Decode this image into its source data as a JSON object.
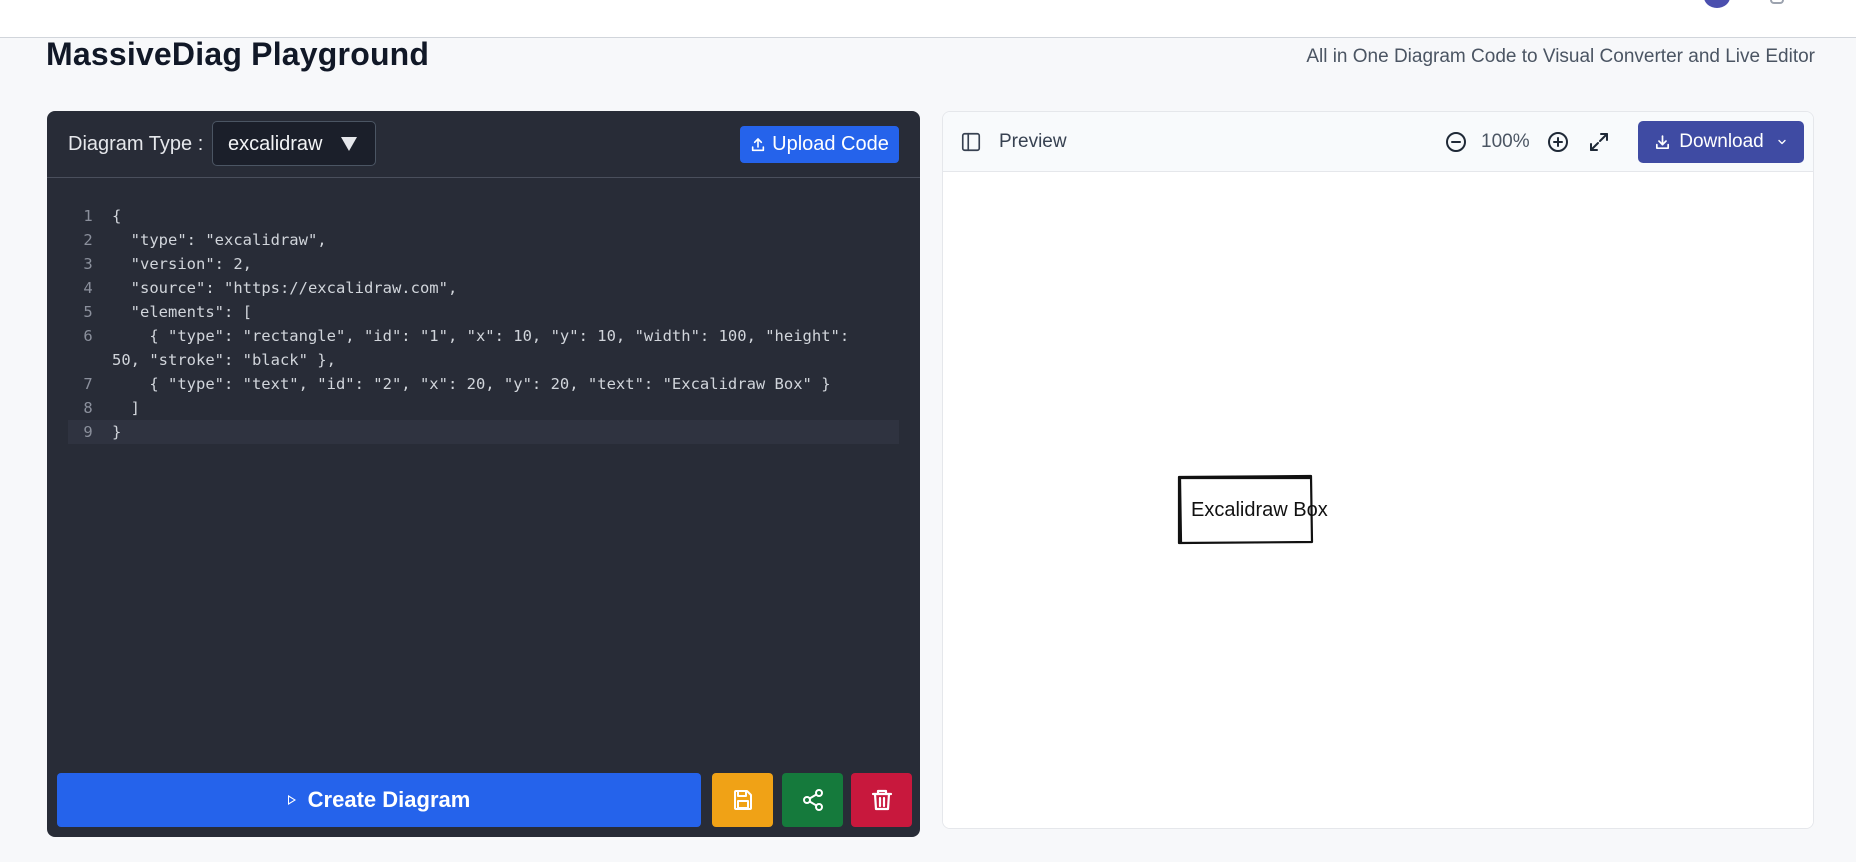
{
  "header": {
    "title": "MassiveDiag Playground",
    "subtitle": "All in One Diagram Code to Visual Converter and Live Editor"
  },
  "editor": {
    "type_label": "Diagram Type :",
    "type_value": "excalidraw",
    "upload_label": "Upload Code",
    "lines": [
      {
        "n": "1",
        "text": "{"
      },
      {
        "n": "2",
        "text": "  \"type\": \"excalidraw\","
      },
      {
        "n": "3",
        "text": "  \"version\": 2,"
      },
      {
        "n": "4",
        "text": "  \"source\": \"https://excalidraw.com\","
      },
      {
        "n": "5",
        "text": "  \"elements\": ["
      },
      {
        "n": "6",
        "text": "    { \"type\": \"rectangle\", \"id\": \"1\", \"x\": 10, \"y\": 10, \"width\": 100, \"height\": 50, \"stroke\": \"black\" },"
      },
      {
        "n": "7",
        "text": "    { \"type\": \"text\", \"id\": \"2\", \"x\": 20, \"y\": 20, \"text\": \"Excalidraw Box\" }"
      },
      {
        "n": "8",
        "text": "  ]"
      },
      {
        "n": "9",
        "text": "}"
      }
    ],
    "active_line": "9",
    "create_label": "Create Diagram"
  },
  "preview": {
    "label": "Preview",
    "zoom": "100%",
    "download_label": "Download",
    "diagram_text": "Excalidraw Box"
  },
  "colors": {
    "primary": "#2563eb",
    "editor_bg": "#282c37",
    "save": "#f0a216",
    "share": "#157a3c",
    "delete": "#c8183d",
    "download": "#3f4ba3"
  }
}
